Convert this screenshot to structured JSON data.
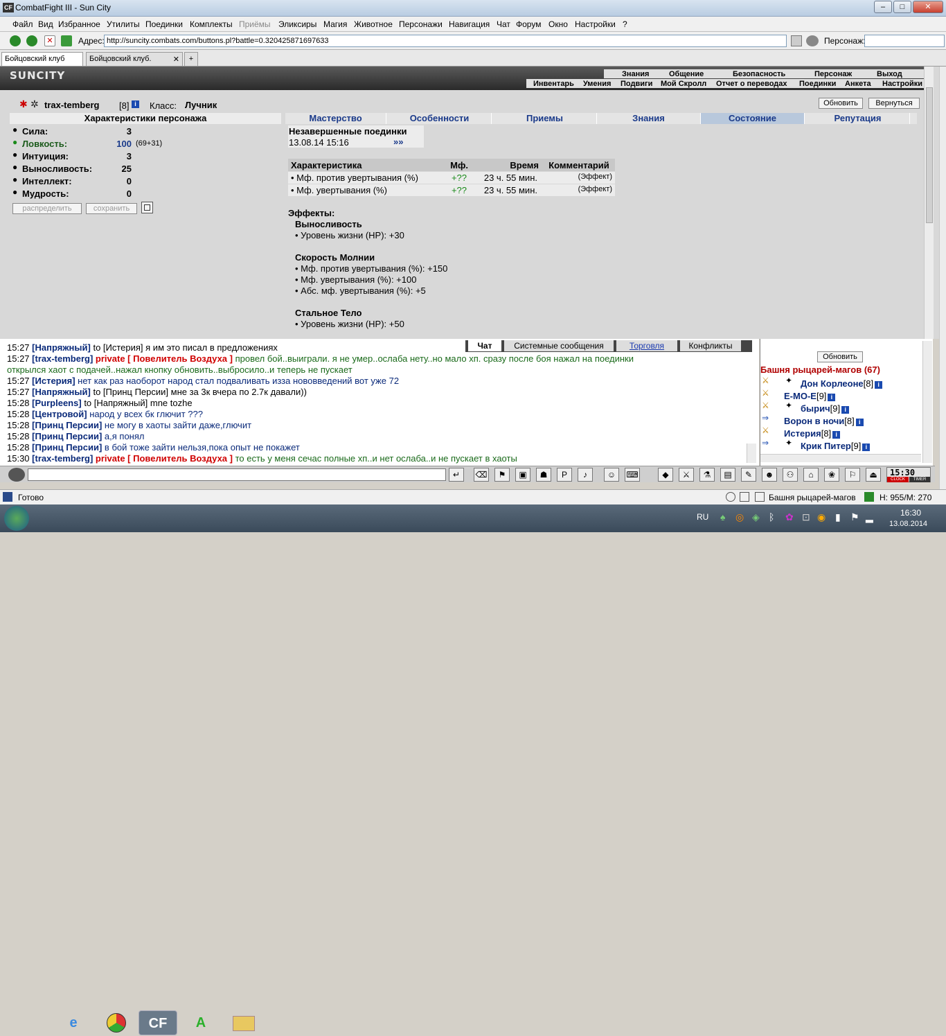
{
  "window": {
    "title": "CombatFight III - Sun City",
    "icon": "CF"
  },
  "menu": [
    "Файл",
    "Вид",
    "Избранное",
    "Утилиты",
    "Поединки",
    "Комплекты",
    "Приёмы",
    "Эликсиры",
    "Магия",
    "Животное",
    "Персонажи",
    "Навигация",
    "Чат",
    "Форум",
    "Окно",
    "Настройки",
    "?"
  ],
  "addr": {
    "label": "Адрес:",
    "url": "http://suncity.combats.com/buttons.pl?battle=0.320425871697633",
    "persona_label": "Персонаж:"
  },
  "tabs": [
    "Бойцовский клуб",
    "Бойцовский клуб."
  ],
  "logo": "SUNCITY",
  "topnav1": [
    "Знания",
    "Общение",
    "Безопасность",
    "Персонаж",
    "Выход"
  ],
  "topnav2": [
    "Инвентарь",
    "Умения",
    "Подвиги",
    "Мой Скролл",
    "Отчет о переводах",
    "Поединки",
    "Анкета",
    "Настройки"
  ],
  "buttons": {
    "refresh": "Обновить",
    "back": "Вернуться",
    "distribute": "распределить",
    "save": "сохранить"
  },
  "character": {
    "name": "trax-temberg",
    "level": "[8]",
    "class_label": "Класс:",
    "class": "Лучник"
  },
  "stats": {
    "header": "Характеристики персонажа",
    "items": [
      {
        "label": "Сила:",
        "value": "3",
        "extra": "",
        "color": "#000000"
      },
      {
        "label": "Ловкость:",
        "value": "100",
        "extra": "(69+31)",
        "color": "#1a5a1a"
      },
      {
        "label": "Интуиция:",
        "value": "3",
        "extra": "",
        "color": "#000000"
      },
      {
        "label": "Выносливость:",
        "value": "25",
        "extra": "",
        "color": "#000000"
      },
      {
        "label": "Интеллект:",
        "value": "0",
        "extra": "",
        "color": "#000000"
      },
      {
        "label": "Мудрость:",
        "value": "0",
        "extra": "",
        "color": "#000000"
      }
    ]
  },
  "sectabs": [
    "Мастерство",
    "Особенности",
    "Приемы",
    "Знания",
    "Состояние",
    "Репутация"
  ],
  "duels": {
    "title": "Незавершенные поединки",
    "date": "13.08.14 15:16",
    "link": "»»"
  },
  "table": {
    "headers": [
      "Характеристика",
      "Мф.",
      "Время",
      "Комментарий"
    ],
    "rows": [
      [
        "• Мф. против увертывания (%)",
        "+??",
        "23 ч. 55 мин.",
        "(Эффект)"
      ],
      [
        "• Мф. увертывания (%)",
        "+??",
        "23 ч. 55 мин.",
        "(Эффект)"
      ]
    ]
  },
  "effects": {
    "title": "Эффекты:",
    "groups": [
      {
        "name": "Выносливость",
        "lines": [
          "• Уровень жизни (HP): +30"
        ]
      },
      {
        "name": "Скорость Молнии",
        "lines": [
          "• Мф. против увертывания (%): +150",
          "• Мф. увертывания (%): +100",
          "• Абс. мф. увертывания (%): +5"
        ]
      },
      {
        "name": "Стальное Тело",
        "lines": [
          "• Уровень жизни (HP): +50"
        ]
      }
    ]
  },
  "chattabs": [
    "Чат",
    "Системные сообщения",
    "Торговля",
    "Конфликты"
  ],
  "chat": [
    {
      "t": "15:27",
      "n": "[Напряжный]",
      "p": "",
      "m": "to [Истерия] я им это писал в предложениях",
      "mc": "#000"
    },
    {
      "t": "15:27",
      "n": "[trax-temberg]",
      "p": "private [ Повелитель Воздуха ]",
      "m": "провел бой..выиграли. я не умер..ослаба нету..но мало хп. сразу после боя нажал на поединки",
      "mc": "#1a6a1a"
    },
    {
      "t": "",
      "n": "",
      "p": "",
      "m": "открылся хаот с подачей..нажал кнопку обновить..выбросило..и теперь не пускает",
      "mc": "#1a6a1a"
    },
    {
      "t": "15:27",
      "n": "[Истерия]",
      "p": "",
      "m": "нет как раз наоборот народ стал подваливать изза нововведений вот уже 72",
      "mc": "#0a2a7a"
    },
    {
      "t": "15:27",
      "n": "[Напряжный]",
      "p": "",
      "m": "to [Принц Персии] мне за 3к вчера по 2.7к давали))",
      "mc": "#000"
    },
    {
      "t": "15:28",
      "n": "[Purpleens]",
      "p": "",
      "m": "to [Напряжный] mne tozhe",
      "mc": "#000"
    },
    {
      "t": "15:28",
      "n": "[Центровой]",
      "p": "",
      "m": "народ у всех бк глючит ???",
      "mc": "#0a2a7a"
    },
    {
      "t": "15:28",
      "n": "[Принц Персии]",
      "p": "",
      "m": "не могу в хаоты зайти даже,глючит",
      "mc": "#0a2a7a"
    },
    {
      "t": "15:28",
      "n": "[Принц Персии]",
      "p": "",
      "m": "а,я понял",
      "mc": "#0a2a7a"
    },
    {
      "t": "15:28",
      "n": "[Принц Персии]",
      "p": "",
      "m": "в бой тоже зайти нельзя,пока опыт не покажет",
      "mc": "#0a2a7a"
    },
    {
      "t": "15:30",
      "n": "[trax-temberg]",
      "p": "private [ Повелитель Воздуха ]",
      "m": "то есть у меня сечас полные хп..и нет ослаба..и не пускает в хаоты",
      "mc": "#1a6a1a"
    }
  ],
  "side": {
    "refresh": "Обновить",
    "room": "Башня рыцарей-магов (67)",
    "users": [
      {
        "name": "Дон Корлеоне",
        "lvl": "[8]"
      },
      {
        "name": "Е-МО-Е",
        "lvl": "[9]"
      },
      {
        "name": "бырич",
        "lvl": "[9]"
      },
      {
        "name": "Ворон в ночи",
        "lvl": "[8]"
      },
      {
        "name": "Истерия",
        "lvl": "[8]"
      },
      {
        "name": "Крик Питер",
        "lvl": "[9]"
      }
    ]
  },
  "clock": {
    "time": "15:30",
    "label1": "CLOCK",
    "label2": "TIMER"
  },
  "status": {
    "ready": "Готово",
    "room": "Башня рыцарей-магов",
    "hp": "H: 955/M: 270"
  },
  "taskbar": {
    "lang": "RU",
    "time": "16:30",
    "date": "13.08.2014"
  }
}
